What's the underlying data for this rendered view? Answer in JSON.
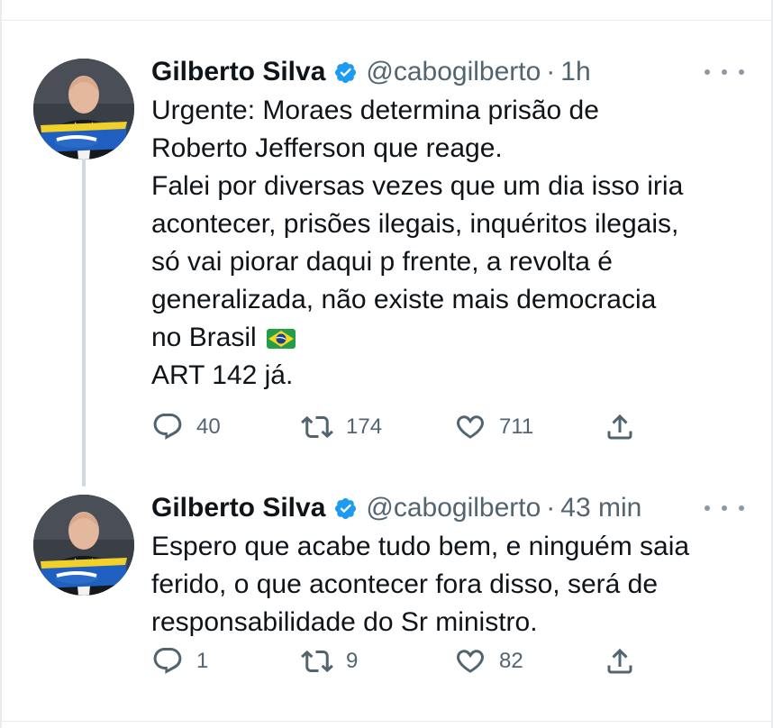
{
  "tweets": [
    {
      "author_name": "Gilberto Silva",
      "handle": "@cabogilberto",
      "separator": "·",
      "time": "1h",
      "lines": [
        "Urgente: Moraes determina prisão de",
        "Roberto Jefferson que reage.",
        "Falei por diversas vezes que um dia isso iria",
        "acontecer, prisões ilegais, inquéritos ilegais,",
        "só vai piorar daqui p frente, a revolta é",
        "generalizada, não existe mais democracia",
        "no Brasil",
        "ART 142 já."
      ],
      "replies": "40",
      "retweets": "174",
      "likes": "711"
    },
    {
      "author_name": "Gilberto Silva",
      "handle": "@cabogilberto",
      "separator": "·",
      "time": "43 min",
      "lines": [
        "Espero que acabe tudo bem, e ninguém saia",
        "ferido, o que acontecer fora disso, será de",
        "responsabilidade do Sr ministro."
      ],
      "replies": "1",
      "retweets": "9",
      "likes": "82"
    }
  ],
  "icons": {
    "verified": "verified-badge-icon",
    "reply": "reply-icon",
    "retweet": "retweet-icon",
    "like": "heart-icon",
    "share": "share-icon",
    "more": "more-dots-icon",
    "flag": "brazil-flag-icon"
  },
  "colors": {
    "verified_blue": "#1d9bf0",
    "secondary_text": "#536471",
    "primary_text": "#0f1419",
    "thread_line": "#cfd9de"
  }
}
